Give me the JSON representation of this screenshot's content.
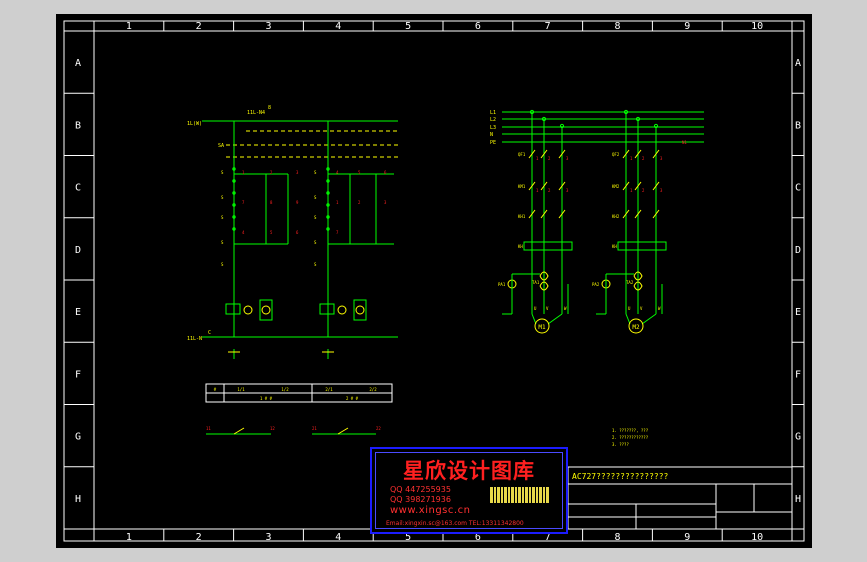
{
  "columns": [
    "1",
    "2",
    "3",
    "4",
    "5",
    "6",
    "7",
    "8",
    "9",
    "10"
  ],
  "rows": [
    "A",
    "B",
    "C",
    "D",
    "E",
    "F",
    "G",
    "H"
  ],
  "title_block": {
    "drawing_title": "AC727???????????????"
  },
  "stamp": {
    "title": "星欣设计图库",
    "qq1": "447255935",
    "qq2": "398271936",
    "website": "www.xingsc.cn",
    "contact": "Email:xingxin.sc@163.com  TEL:13311342800"
  },
  "left_circuit": {
    "top_labels": [
      "1L(W)",
      "11L-N4",
      "8"
    ],
    "supply_label": "SA",
    "bottom_label": "11L-N",
    "bottom_c": "C",
    "table_cells": [
      "1/1",
      "1/2",
      "2/1",
      "2/2"
    ],
    "table_sub": [
      "1 # #",
      "2 # #"
    ]
  },
  "right_circuit": {
    "bus_labels": [
      "L1",
      "L2",
      "L3",
      "N",
      "PE"
    ],
    "motor1": "M1",
    "motor2": "M2",
    "device_labels": [
      "QF1",
      "KM1",
      "KH1",
      "QF2",
      "KM2",
      "KH2",
      "TA1",
      "TA2",
      "PA1",
      "PA2"
    ],
    "notes": [
      "1. ???????, ???",
      "2. ????????????",
      "3. ????"
    ]
  },
  "colors": {
    "wire": "#00ff00",
    "label": "#ff2020",
    "frame": "#ffffff",
    "text": "#ffff00",
    "accent": "#00ffff"
  }
}
